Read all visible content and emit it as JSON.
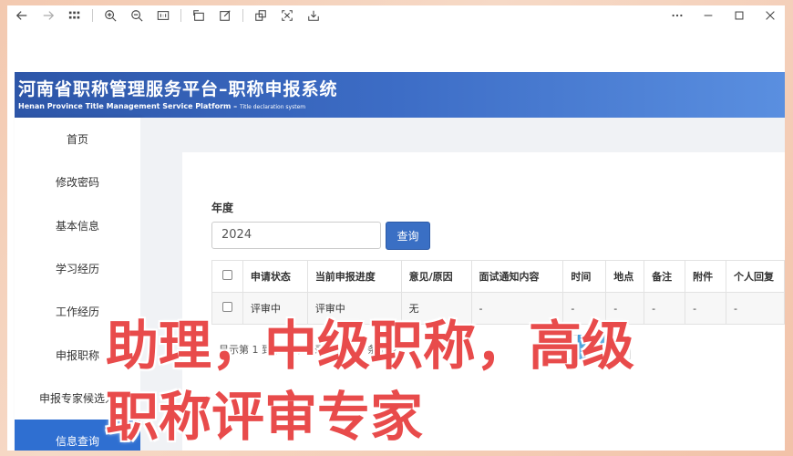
{
  "banner": {
    "title": "河南省职称管理服务平台–职称申报系统",
    "subtitle": "Henan Province Title Management Service Platform –",
    "subtitle_small": "Title declaration system"
  },
  "sidebar": {
    "items": [
      {
        "label": "首页"
      },
      {
        "label": "修改密码"
      },
      {
        "label": "基本信息"
      },
      {
        "label": "学习经历"
      },
      {
        "label": "工作经历"
      },
      {
        "label": "申报职称"
      },
      {
        "label": "申报专家候选人"
      },
      {
        "label": "信息查询"
      }
    ]
  },
  "form": {
    "year_label": "年度",
    "year_value": "2024",
    "query_label": "查询"
  },
  "table": {
    "headers": [
      "申请状态",
      "当前申报进度",
      "意见/原因",
      "面试通知内容",
      "时间",
      "地点",
      "备注",
      "附件",
      "个人回复"
    ],
    "rows": [
      [
        "评审中",
        "评审中",
        "无",
        "-",
        "-",
        "-",
        "-",
        "-",
        "-"
      ]
    ]
  },
  "pagination": {
    "summary": "显示第 1 到第 1 条记录，总共 1 条记录",
    "prev": "‹",
    "current": "1",
    "next": "›"
  },
  "overlay": {
    "line1": "助理，中级职称，高级",
    "line2": "职称评审专家"
  }
}
